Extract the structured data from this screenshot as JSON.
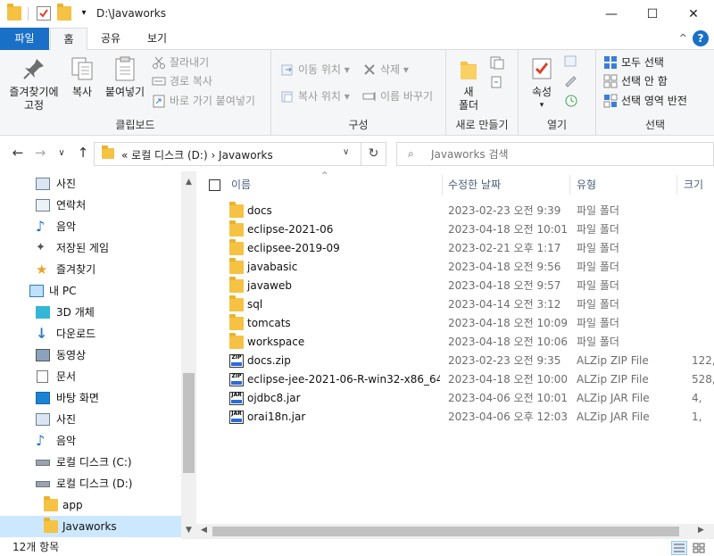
{
  "window": {
    "title": "D:\\Javaworks",
    "minimize_glyph": "—",
    "maximize_glyph": "☐",
    "close_glyph": "✕"
  },
  "quick_access": {
    "dropdown_glyph": "▾"
  },
  "ribbon_tabs": {
    "file": "파일",
    "home": "홈",
    "share": "공유",
    "view": "보기",
    "help": "?",
    "collapse": "^"
  },
  "ribbon": {
    "clipboard": {
      "label": "클립보드",
      "pin": [
        "즐겨찾기에",
        "고정"
      ],
      "copy": "복사",
      "paste": "붙여넣기",
      "cut": "잘라내기",
      "copy_path": "경로 복사",
      "paste_shortcut": "바로 가기 붙여넣기"
    },
    "organize": {
      "label": "구성",
      "move_to": "이동 위치",
      "copy_to": "복사 위치",
      "delete": "삭제",
      "rename": "이름 바꾸기"
    },
    "new": {
      "label": "새로 만들기",
      "new_folder": [
        "새",
        "폴더"
      ]
    },
    "open": {
      "label": "열기",
      "properties": "속성"
    },
    "select": {
      "label": "선택",
      "select_all": "모두 선택",
      "select_none": "선택 안 함",
      "invert": "선택 영역 반전"
    }
  },
  "navigation": {
    "back": "←",
    "forward": "→",
    "recent": "∨",
    "up": "↑",
    "address": "«  로컬 디스크 (D:)  ›  Javaworks",
    "address_dropdown": "∨",
    "refresh": "↻",
    "search_placeholder": "Javaworks 검색",
    "search_icon_glyph": "⌕"
  },
  "nav_pane": {
    "scroll_up": "▲",
    "scroll_down": "▼",
    "items": [
      {
        "label": "사진",
        "icon": "pictures-icon"
      },
      {
        "label": "연락처",
        "icon": "contacts-icon"
      },
      {
        "label": "음악",
        "icon": "music-icon"
      },
      {
        "label": "저장된 게임",
        "icon": "saved-games-icon"
      },
      {
        "label": "즐겨찾기",
        "icon": "favorites-icon"
      },
      {
        "label": "내 PC",
        "icon": "this-pc-icon"
      },
      {
        "label": "3D 개체",
        "icon": "3d-objects-icon"
      },
      {
        "label": "다운로드",
        "icon": "downloads-icon"
      },
      {
        "label": "동영상",
        "icon": "videos-icon"
      },
      {
        "label": "문서",
        "icon": "documents-icon"
      },
      {
        "label": "바탕 화면",
        "icon": "desktop-icon"
      },
      {
        "label": "사진",
        "icon": "pictures-icon"
      },
      {
        "label": "음악",
        "icon": "music-icon"
      },
      {
        "label": "로컬 디스크 (C:)",
        "icon": "drive-c-icon"
      },
      {
        "label": "로컬 디스크 (D:)",
        "icon": "drive-d-icon"
      },
      {
        "label": "app",
        "icon": "folder-icon"
      },
      {
        "label": "Javaworks",
        "icon": "folder-icon"
      }
    ]
  },
  "file_list": {
    "columns": {
      "name": "이름",
      "modified": "수정한 날짜",
      "type": "유형",
      "size": "크기"
    },
    "sort_glyph": "^",
    "scroll_left": "◀",
    "scroll_right": "▶",
    "rows": [
      {
        "name": "docs",
        "modified": "2023-02-23 오전 9:39",
        "type": "파일 폴더",
        "size": "",
        "kind": "folder"
      },
      {
        "name": "eclipse-2021-06",
        "modified": "2023-04-18 오전 10:01",
        "type": "파일 폴더",
        "size": "",
        "kind": "folder"
      },
      {
        "name": "eclipsee-2019-09",
        "modified": "2023-02-21 오후 1:17",
        "type": "파일 폴더",
        "size": "",
        "kind": "folder"
      },
      {
        "name": "javabasic",
        "modified": "2023-04-18 오전 9:56",
        "type": "파일 폴더",
        "size": "",
        "kind": "folder"
      },
      {
        "name": "javaweb",
        "modified": "2023-04-18 오전 9:57",
        "type": "파일 폴더",
        "size": "",
        "kind": "folder"
      },
      {
        "name": "sql",
        "modified": "2023-04-14 오전 3:12",
        "type": "파일 폴더",
        "size": "",
        "kind": "folder"
      },
      {
        "name": "tomcats",
        "modified": "2023-04-18 오전 10:09",
        "type": "파일 폴더",
        "size": "",
        "kind": "folder"
      },
      {
        "name": "workspace",
        "modified": "2023-04-18 오전 10:06",
        "type": "파일 폴더",
        "size": "",
        "kind": "folder"
      },
      {
        "name": "docs.zip",
        "modified": "2023-02-23 오전 9:35",
        "type": "ALZip ZIP File",
        "size": "122,",
        "kind": "zip"
      },
      {
        "name": "eclipse-jee-2021-06-R-win32-x86_64...",
        "modified": "2023-04-18 오전 10:00",
        "type": "ALZip ZIP File",
        "size": "528,",
        "kind": "zip"
      },
      {
        "name": "ojdbc8.jar",
        "modified": "2023-04-06 오전 10:01",
        "type": "ALZip JAR File",
        "size": "4,",
        "kind": "jar"
      },
      {
        "name": "orai18n.jar",
        "modified": "2023-04-06 오후 12:03",
        "type": "ALZip JAR File",
        "size": "1,",
        "kind": "jar"
      }
    ]
  },
  "status_bar": {
    "item_count": "12개 항목"
  },
  "colors": {
    "accent": "#1a6fc7",
    "folder": "#f5c243",
    "selection": "#cce8ff"
  }
}
